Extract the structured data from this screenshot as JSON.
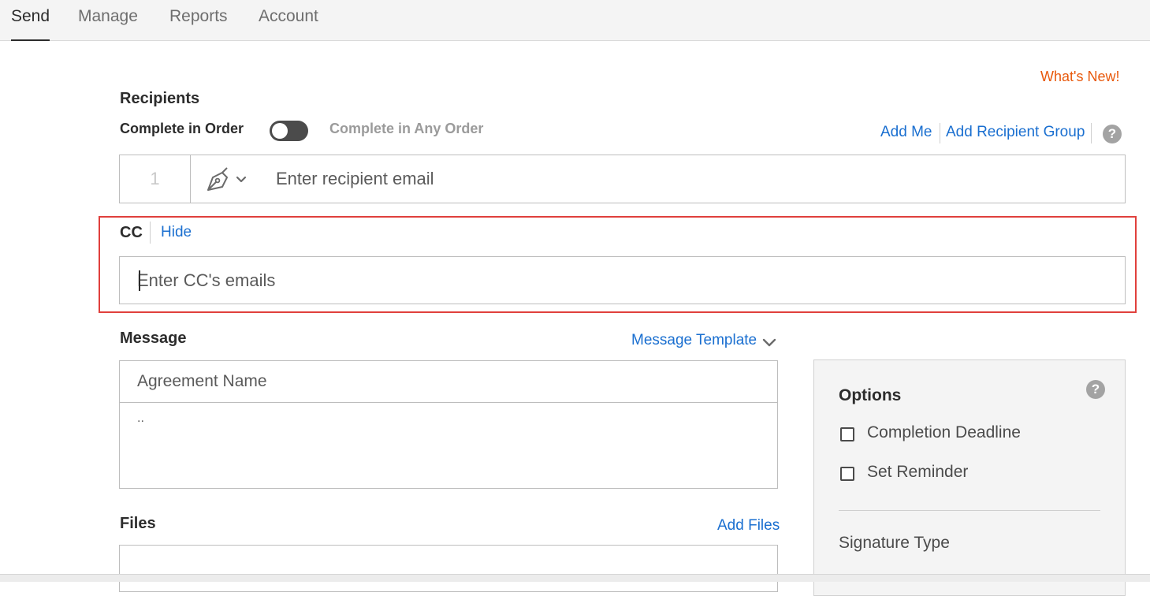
{
  "nav": {
    "tabs": [
      {
        "label": "Send"
      },
      {
        "label": "Manage"
      },
      {
        "label": "Reports"
      },
      {
        "label": "Account"
      }
    ],
    "active_tab": "Send"
  },
  "whats_new": "What's New!",
  "recipients": {
    "title": "Recipients",
    "order_label": "Complete in Order",
    "any_order_label": "Complete in Any Order",
    "add_me": "Add Me",
    "add_group": "Add Recipient Group",
    "help_glyph": "?",
    "rows": [
      {
        "index": "1",
        "role_icon": "pen-nib-icon",
        "placeholder": "Enter recipient email",
        "value": ""
      }
    ]
  },
  "cc": {
    "label": "CC",
    "hide": "Hide",
    "placeholder": "Enter CC's emails",
    "value": ""
  },
  "message": {
    "title": "Message",
    "template_link": "Message Template",
    "agreement_placeholder": "Agreement Name",
    "body": ".."
  },
  "files": {
    "title": "Files",
    "add_files": "Add Files"
  },
  "options": {
    "title": "Options",
    "help_glyph": "?",
    "items": [
      {
        "label": "Completion Deadline",
        "checked": false
      },
      {
        "label": "Set Reminder",
        "checked": false
      }
    ],
    "signature_type": "Signature Type"
  },
  "colors": {
    "link": "#1a6fd0",
    "whats_new": "#e8590c",
    "highlight": "#e0403c"
  }
}
